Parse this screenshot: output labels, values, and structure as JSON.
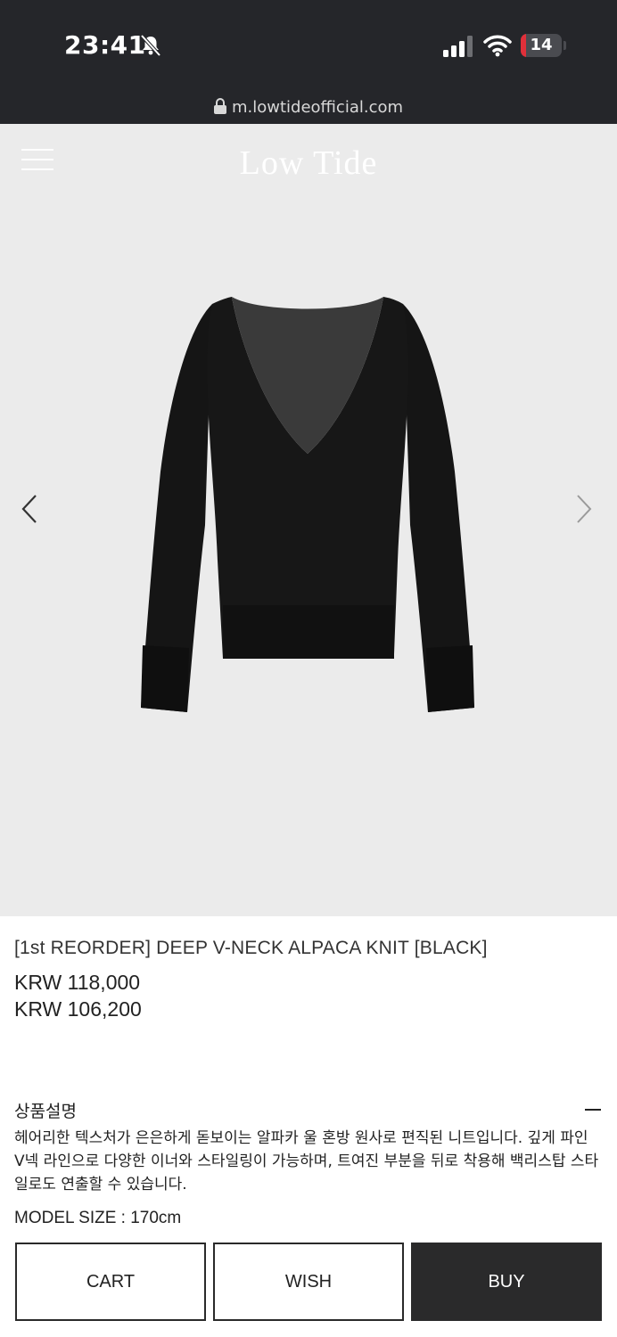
{
  "status_bar": {
    "time": "23:41",
    "battery": "14",
    "battery_level": 0.14
  },
  "browser": {
    "url": "m.lowtideofficial.com"
  },
  "header": {
    "logo": "Low Tide"
  },
  "product": {
    "title": "[1st REORDER] DEEP V-NECK ALPACA KNIT [BLACK]",
    "price_original": "KRW 118,000",
    "price_sale": "KRW 106,200"
  },
  "description": {
    "heading": "상품설명",
    "body": "헤어리한 텍스처가 은은하게 돋보이는 알파카 울 혼방 원사로 편직된 니트입니다. 깊게 파인 V넥 라인으로 다양한 이너와 스타일링이 가능하며, 트여진 부분을 뒤로 착용해 백리스탑 스타일로도 연출할 수 있습니다.",
    "model_size": "MODEL SIZE : 170cm"
  },
  "actions": {
    "cart": "CART",
    "wish": "WISH",
    "buy": "BUY"
  },
  "colors": {
    "chrome_bg": "#25262a",
    "hero_bg": "#ebebeb",
    "buy_bg": "#2a2a2b",
    "battery_red": "#e0303a"
  }
}
